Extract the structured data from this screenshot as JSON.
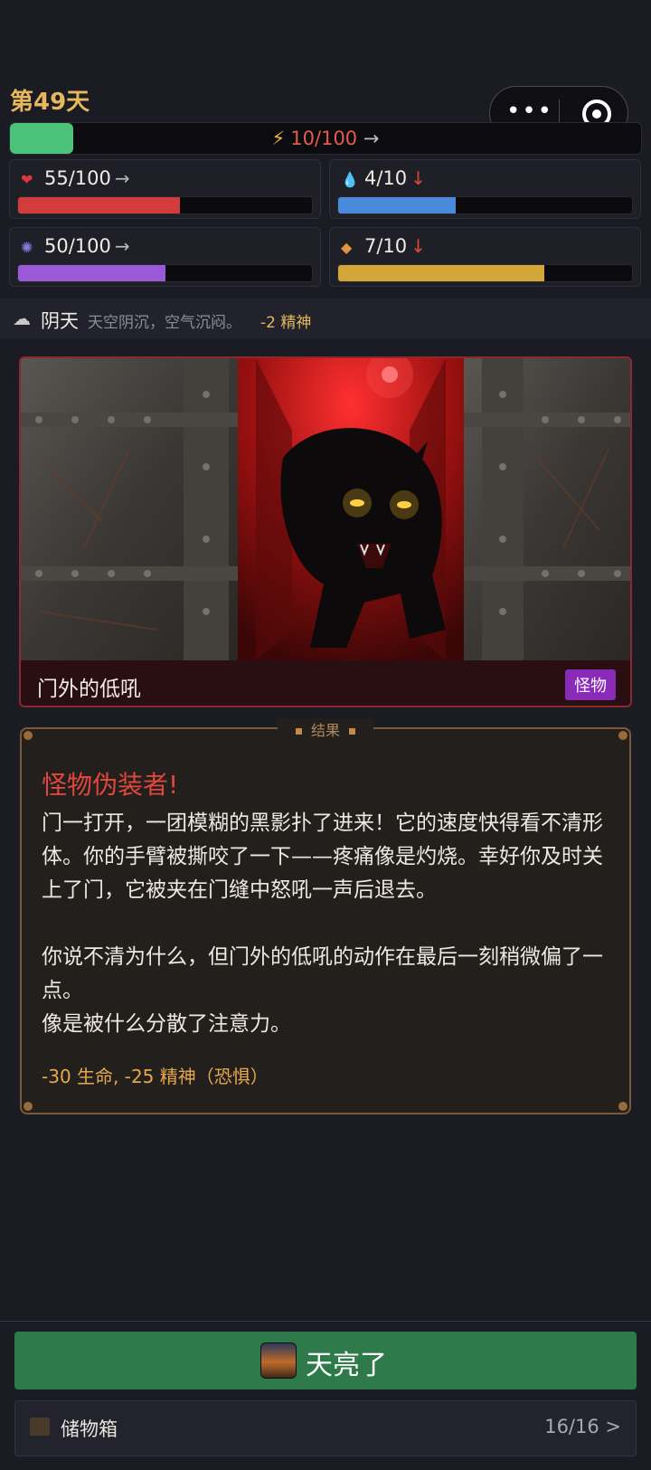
{
  "header": {
    "day": "第49天",
    "energy": {
      "label": "10/100",
      "arrow": "→",
      "fraction": 0.1
    }
  },
  "stats": [
    {
      "name": "health",
      "label": "55/100",
      "arrow": "→",
      "trend": "flat",
      "fraction": 0.55,
      "color": "#d23c3c",
      "icon": "heart-icon"
    },
    {
      "name": "water",
      "label": "4/10",
      "arrow": "↓",
      "trend": "down",
      "fraction": 0.4,
      "color": "#4a8adc",
      "icon": "water-drop-icon"
    },
    {
      "name": "mind",
      "label": "50/100",
      "arrow": "→",
      "trend": "flat",
      "fraction": 0.5,
      "color": "#9a5ad8",
      "icon": "brain-icon"
    },
    {
      "name": "food",
      "label": "7/10",
      "arrow": "↓",
      "trend": "down",
      "fraction": 0.7,
      "color": "#d4a63a",
      "icon": "bread-icon"
    }
  ],
  "weather": {
    "name": "阴天",
    "desc": "天空阴沉，空气沉闷。",
    "effect": "-2 精神"
  },
  "event": {
    "title": "门外的低吼",
    "tag": "怪物"
  },
  "result": {
    "legend": "结果",
    "title": "怪物伪装者!",
    "body": "门一打开，一团模糊的黑影扑了进来！它的速度快得看不清形体。你的手臂被撕咬了一下——疼痛像是灼烧。幸好你及时关上了门，它被夹在门缝中怒吼一声后退去。\n\n你说不清为什么，但门外的低吼的动作在最后一刻稍微偏了一点。\n像是被什么分散了注意力。",
    "effects": "-30 生命, -25 精神（恐惧）"
  },
  "actions": {
    "dawn_label": "天亮了",
    "storage_label": "储物箱",
    "storage_count": "16/16 >"
  }
}
